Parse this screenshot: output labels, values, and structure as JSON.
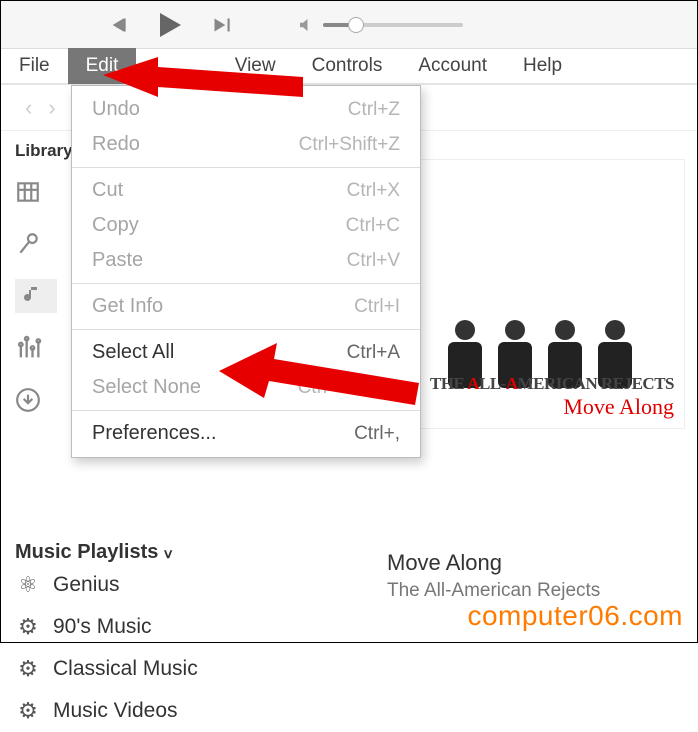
{
  "menubar": {
    "file": "File",
    "edit": "Edit",
    "view": "View",
    "controls": "Controls",
    "account": "Account",
    "help": "Help"
  },
  "sidebar": {
    "library_header": "Library",
    "music_playlists_header": "Music Playlists",
    "playlists": [
      {
        "label": "Genius"
      },
      {
        "label": "90's Music"
      },
      {
        "label": "Classical Music"
      },
      {
        "label": "Music Videos"
      }
    ]
  },
  "edit_menu": {
    "undo": {
      "label": "Undo",
      "shortcut": "Ctrl+Z"
    },
    "redo": {
      "label": "Redo",
      "shortcut": "Ctrl+Shift+Z"
    },
    "cut": {
      "label": "Cut",
      "shortcut": "Ctrl+X"
    },
    "copy": {
      "label": "Copy",
      "shortcut": "Ctrl+C"
    },
    "paste": {
      "label": "Paste",
      "shortcut": "Ctrl+V"
    },
    "get_info": {
      "label": "Get Info",
      "shortcut": "Ctrl+I"
    },
    "select_all": {
      "label": "Select All",
      "shortcut": "Ctrl+A"
    },
    "select_none": {
      "label": "Select None",
      "shortcut": "Ctrl+Shift+A"
    },
    "preferences": {
      "label": "Preferences...",
      "shortcut": "Ctrl+,"
    }
  },
  "album": {
    "line1_prefix": "THE ",
    "line1_a": "A",
    "line1_mid": "LL-",
    "line1_a2": "A",
    "line1_rest": "MERICAN REJECTS",
    "line2": "Move Along"
  },
  "track": {
    "title": "Move Along",
    "artist": "The All-American Rejects"
  },
  "watermark": "computer06.com"
}
